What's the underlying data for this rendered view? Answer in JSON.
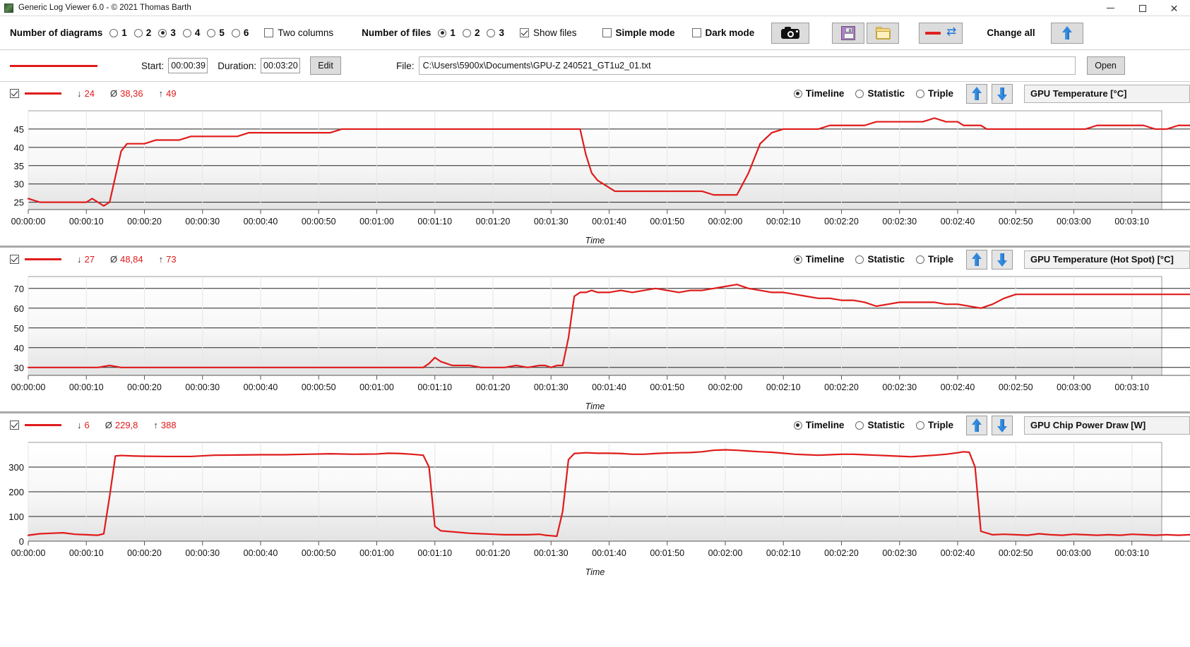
{
  "window": {
    "title": "Generic Log Viewer 6.0 - © 2021 Thomas Barth",
    "icon": "app-icon",
    "minimize": "–",
    "maximize": "▢",
    "close": "✕"
  },
  "toolbar": {
    "number_of_diagrams_label": "Number of diagrams",
    "diagram_options": [
      "1",
      "2",
      "3",
      "4",
      "5",
      "6"
    ],
    "diagram_selected": "3",
    "two_columns_label": "Two columns",
    "two_columns_checked": false,
    "number_of_files_label": "Number of files",
    "file_options": [
      "1",
      "2",
      "3"
    ],
    "file_selected": "1",
    "show_files_label": "Show files",
    "show_files_checked": true,
    "simple_mode_label": "Simple mode",
    "simple_mode_checked": false,
    "dark_mode_label": "Dark mode",
    "dark_mode_checked": false,
    "screenshot_icon": "camera-icon",
    "save_icon": "floppy-disk-icon",
    "open_icon": "folder-icon",
    "swap_icon": "swap-color-icon",
    "change_all_label": "Change all",
    "change_all_up_icon": "blue-up-arrow-icon"
  },
  "filebar": {
    "legend_color": "#e01b1b",
    "start_label": "Start:",
    "start_value": "00:00:39",
    "duration_label": "Duration:",
    "duration_value": "00:03:20",
    "edit_label": "Edit",
    "file_label": "File:",
    "file_value": "C:\\Users\\5900x\\Documents\\GPU-Z 240521_GT1u2_01.txt",
    "open_label": "Open"
  },
  "mode_labels": {
    "timeline": "Timeline",
    "statistic": "Statistic",
    "triple": "Triple"
  },
  "axis": {
    "time_label": "Time"
  },
  "x_ticks": [
    "00:00:00",
    "00:00:10",
    "00:00:20",
    "00:00:30",
    "00:00:40",
    "00:00:50",
    "00:01:00",
    "00:01:10",
    "00:01:20",
    "00:01:30",
    "00:01:40",
    "00:01:50",
    "00:02:00",
    "00:02:10",
    "00:02:20",
    "00:02:30",
    "00:02:40",
    "00:02:50",
    "00:03:00",
    "00:03:10"
  ],
  "panels": [
    {
      "enabled": true,
      "min_label": "↓",
      "min": "24",
      "avg_label": "Ø",
      "avg": "38,36",
      "max_label": "↑",
      "max": "49",
      "mode_selected": "Timeline",
      "series_name": "GPU Temperature [°C]",
      "up_icon": "blue-up-arrow-icon",
      "down_icon": "blue-down-arrow-icon"
    },
    {
      "enabled": true,
      "min_label": "↓",
      "min": "27",
      "avg_label": "Ø",
      "avg": "48,84",
      "max_label": "↑",
      "max": "73",
      "mode_selected": "Timeline",
      "series_name": "GPU Temperature (Hot Spot) [°C]",
      "up_icon": "blue-up-arrow-icon",
      "down_icon": "blue-down-arrow-icon"
    },
    {
      "enabled": true,
      "min_label": "↓",
      "min": "6",
      "avg_label": "Ø",
      "avg": "229,8",
      "max_label": "↑",
      "max": "388",
      "mode_selected": "Timeline",
      "series_name": "GPU Chip Power Draw [W]",
      "up_icon": "blue-up-arrow-icon",
      "down_icon": "blue-down-arrow-icon"
    }
  ],
  "chart_data": [
    {
      "type": "line",
      "title": "GPU Temperature [°C]",
      "xlabel": "Time",
      "ylabel": "",
      "line_color": "#e01b1b",
      "grid": true,
      "ylim": [
        23,
        50
      ],
      "yticks": [
        25,
        30,
        35,
        40,
        45
      ],
      "xlim": [
        0,
        200
      ],
      "xticks": [
        0,
        10,
        20,
        30,
        40,
        50,
        60,
        70,
        80,
        90,
        100,
        110,
        120,
        130,
        140,
        150,
        160,
        170,
        180,
        190
      ],
      "x": [
        0,
        2,
        4,
        6,
        8,
        10,
        11,
        12,
        13,
        14,
        15,
        16,
        17,
        18,
        19,
        20,
        22,
        24,
        26,
        28,
        30,
        32,
        34,
        36,
        38,
        40,
        42,
        44,
        46,
        48,
        50,
        52,
        54,
        56,
        58,
        60,
        62,
        64,
        66,
        67,
        68,
        69,
        70,
        71,
        72,
        73,
        74,
        75,
        76,
        78,
        80,
        82,
        84,
        86,
        88,
        89,
        90,
        91,
        92,
        93,
        94,
        95,
        96,
        97,
        98,
        99,
        100,
        101,
        102,
        103,
        104,
        105,
        106,
        108,
        110,
        112,
        114,
        116,
        118,
        120,
        122,
        124,
        126,
        128,
        130,
        132,
        134,
        136,
        138,
        140,
        142,
        144,
        146,
        148,
        150,
        152,
        154,
        156,
        158,
        160,
        161,
        162,
        163,
        164,
        165,
        166,
        168,
        170,
        172,
        174,
        176,
        178,
        180,
        182,
        184,
        186,
        188,
        190,
        192,
        194,
        196,
        198,
        200
      ],
      "y": [
        26,
        25,
        25,
        25,
        25,
        25,
        26,
        25,
        24,
        25,
        32,
        39,
        41,
        41,
        41,
        41,
        42,
        42,
        42,
        43,
        43,
        43,
        43,
        43,
        44,
        44,
        44,
        44,
        44,
        44,
        44,
        44,
        45,
        45,
        45,
        45,
        45,
        45,
        45,
        45,
        45,
        45,
        45,
        45,
        45,
        45,
        45,
        45,
        45,
        45,
        45,
        45,
        45,
        45,
        45,
        45,
        45,
        45,
        45,
        45,
        45,
        45,
        38,
        33,
        31,
        30,
        29,
        28,
        28,
        28,
        28,
        28,
        28,
        28,
        28,
        28,
        28,
        28,
        27,
        27,
        27,
        33,
        41,
        44,
        45,
        45,
        45,
        45,
        46,
        46,
        46,
        46,
        47,
        47,
        47,
        47,
        47,
        48,
        47,
        47,
        46,
        46,
        46,
        46,
        45,
        45,
        45,
        45,
        45,
        45,
        45,
        45,
        45,
        45,
        46,
        46,
        46,
        46,
        46,
        45,
        45,
        46,
        46
      ]
    },
    {
      "type": "line",
      "title": "GPU Temperature (Hot Spot) [°C]",
      "xlabel": "Time",
      "ylabel": "",
      "line_color": "#e01b1b",
      "grid": true,
      "ylim": [
        26,
        76
      ],
      "yticks": [
        30,
        40,
        50,
        60,
        70
      ],
      "xlim": [
        0,
        200
      ],
      "xticks": [
        0,
        10,
        20,
        30,
        40,
        50,
        60,
        70,
        80,
        90,
        100,
        110,
        120,
        130,
        140,
        150,
        160,
        170,
        180,
        190
      ],
      "x": [
        0,
        5,
        10,
        12,
        14,
        16,
        18,
        20,
        25,
        30,
        35,
        40,
        45,
        50,
        55,
        60,
        65,
        68,
        69,
        70,
        71,
        72,
        73,
        74,
        75,
        76,
        78,
        80,
        82,
        84,
        86,
        88,
        89,
        90,
        91,
        92,
        93,
        94,
        95,
        96,
        97,
        98,
        100,
        102,
        104,
        106,
        108,
        110,
        112,
        114,
        116,
        118,
        120,
        122,
        124,
        126,
        128,
        130,
        132,
        134,
        136,
        138,
        140,
        142,
        144,
        146,
        148,
        150,
        152,
        154,
        156,
        158,
        160,
        162,
        164,
        166,
        168,
        170,
        172,
        174,
        176,
        178,
        180,
        185,
        190,
        195,
        200
      ],
      "y": [
        30,
        30,
        30,
        30,
        31,
        30,
        30,
        30,
        30,
        30,
        30,
        30,
        30,
        30,
        30,
        30,
        30,
        30,
        32,
        35,
        33,
        32,
        31,
        31,
        31,
        31,
        30,
        30,
        30,
        31,
        30,
        31,
        31,
        30,
        31,
        31,
        45,
        66,
        68,
        68,
        69,
        68,
        68,
        69,
        68,
        69,
        70,
        69,
        68,
        69,
        69,
        70,
        71,
        72,
        70,
        69,
        68,
        68,
        67,
        66,
        65,
        65,
        64,
        64,
        63,
        61,
        62,
        63,
        63,
        63,
        63,
        62,
        62,
        61,
        60,
        62,
        65,
        67,
        67,
        67,
        67,
        67,
        67,
        67,
        67,
        67,
        67
      ]
    },
    {
      "type": "line",
      "title": "GPU Chip Power Draw [W]",
      "xlabel": "Time",
      "ylabel": "",
      "line_color": "#e01b1b",
      "grid": true,
      "ylim": [
        0,
        400
      ],
      "yticks": [
        0,
        100,
        200,
        300
      ],
      "xlim": [
        0,
        200
      ],
      "xticks": [
        0,
        10,
        20,
        30,
        40,
        50,
        60,
        70,
        80,
        90,
        100,
        110,
        120,
        130,
        140,
        150,
        160,
        170,
        180,
        190
      ],
      "x": [
        0,
        2,
        4,
        6,
        8,
        10,
        12,
        13,
        14,
        15,
        16,
        18,
        20,
        24,
        28,
        32,
        36,
        40,
        44,
        48,
        52,
        56,
        60,
        62,
        64,
        66,
        68,
        69,
        70,
        71,
        72,
        74,
        76,
        78,
        80,
        82,
        84,
        86,
        88,
        89,
        90,
        91,
        92,
        93,
        94,
        96,
        98,
        100,
        102,
        104,
        106,
        108,
        110,
        112,
        114,
        116,
        118,
        120,
        122,
        124,
        126,
        128,
        130,
        132,
        134,
        136,
        138,
        140,
        142,
        144,
        146,
        148,
        150,
        152,
        154,
        156,
        158,
        160,
        161,
        162,
        163,
        164,
        166,
        168,
        170,
        172,
        174,
        176,
        178,
        180,
        182,
        184,
        186,
        188,
        190,
        192,
        194,
        196,
        198,
        200
      ],
      "y": [
        24,
        30,
        32,
        34,
        28,
        26,
        24,
        30,
        180,
        345,
        347,
        345,
        344,
        343,
        343,
        348,
        349,
        350,
        350,
        352,
        354,
        352,
        353,
        356,
        355,
        352,
        348,
        300,
        60,
        42,
        40,
        36,
        32,
        30,
        28,
        26,
        26,
        26,
        28,
        24,
        22,
        20,
        120,
        330,
        355,
        358,
        356,
        356,
        355,
        352,
        352,
        355,
        357,
        358,
        359,
        362,
        368,
        370,
        368,
        365,
        362,
        360,
        356,
        352,
        350,
        348,
        350,
        352,
        352,
        350,
        348,
        346,
        344,
        342,
        345,
        348,
        352,
        358,
        362,
        360,
        300,
        40,
        26,
        28,
        26,
        24,
        30,
        26,
        24,
        28,
        26,
        24,
        26,
        24,
        28,
        26,
        24,
        26,
        24,
        26
      ]
    }
  ]
}
